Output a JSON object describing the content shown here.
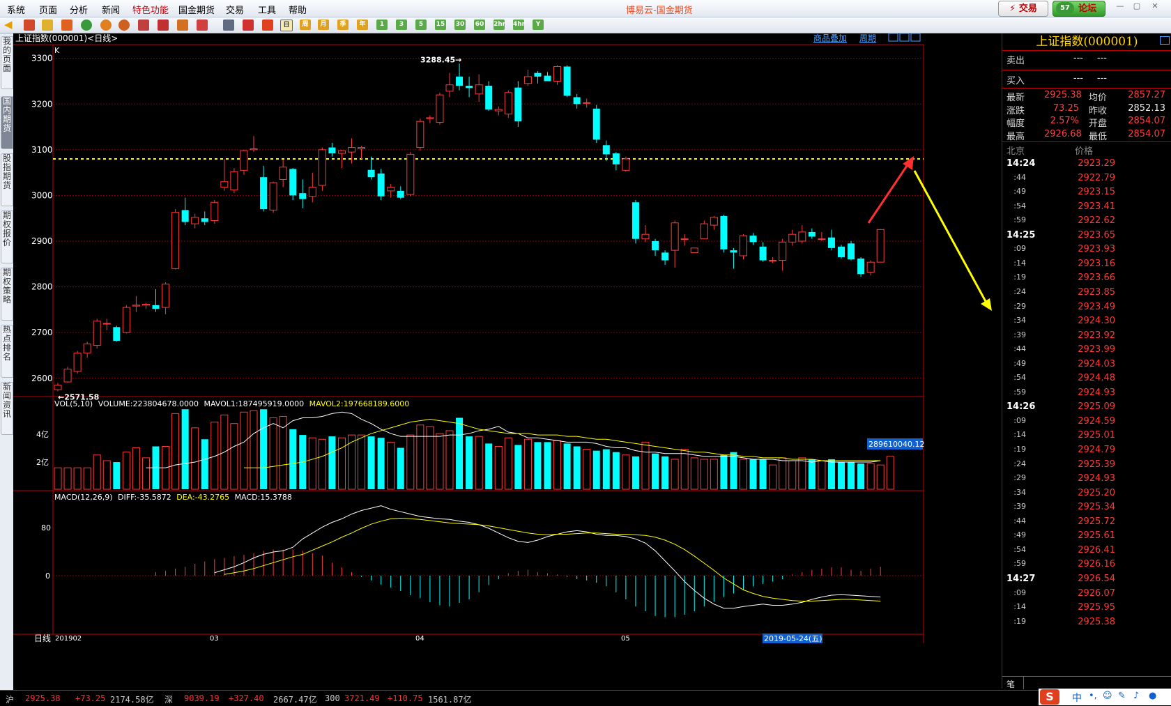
{
  "menu": {
    "items": [
      "系统",
      "页面",
      "分析",
      "新闻",
      "特色功能",
      "国金期货",
      "交易",
      "工具",
      "帮助"
    ],
    "app_title": "博易云-国金期货",
    "trade_button": "⚡ 交易",
    "forum_button": "论坛",
    "forum_badge": "57"
  },
  "toolbar": {
    "period_buttons": [
      "日",
      "周",
      "月",
      "季",
      "年",
      "1",
      "3",
      "5",
      "15",
      "30",
      "60",
      "2hr",
      "4hr",
      "Y"
    ]
  },
  "side_tabs": [
    "我的页面",
    "国内期货",
    "股指期货",
    "期权报价",
    "期权策略",
    "热点排名",
    "新闻资讯"
  ],
  "chart_header": {
    "title": "上证指数(000001)<日线>",
    "overlay_link": "商品叠加",
    "period_link": "周期",
    "k_label": "K"
  },
  "price_axis": [
    "3300",
    "3200",
    "3100",
    "3000",
    "2900",
    "2800",
    "2700",
    "2600"
  ],
  "annotations": {
    "high": "3288.45→",
    "low": "←2571.58"
  },
  "volume_panel": {
    "label": "VOL(5,10)",
    "volume": "VOLUME:223804678.0000",
    "mavol1": "MAVOL1:187495919.0000",
    "mavol2": "MAVOL2:197668189.6000",
    "axis": [
      "4亿",
      "2亿"
    ],
    "tag": "289610040.12"
  },
  "macd_panel": {
    "label": "MACD(12,26,9)",
    "diff": "DIFF:-35.5872",
    "dea": "DEA:-43.2765",
    "macd": "MACD:15.3788",
    "axis": [
      "80",
      "0"
    ]
  },
  "x_axis": {
    "label": "日线",
    "ticks": [
      "201902",
      "03",
      "04",
      "05"
    ],
    "cursor_date": "2019-05-24(五)"
  },
  "colors": {
    "up": "#ff3b3b",
    "down": "#00ffff",
    "bg": "#000000",
    "grid": "#8b0000",
    "dashed": "#ffff00",
    "ma1": "#ffffff",
    "ma2": "#ffff00"
  },
  "quote": {
    "title": "上证指数(000001)",
    "sell_label": "卖出",
    "buy_label": "买入",
    "dashes": "---",
    "rows": [
      {
        "l1": "最新",
        "v1": "2925.38",
        "l2": "均价",
        "v2": "2857.27"
      },
      {
        "l1": "涨跌",
        "v1": "73.25",
        "l2": "昨收",
        "v2": "2852.13"
      },
      {
        "l1": "幅度",
        "v1": "2.57%",
        "l2": "开盘",
        "v2": "2854.07"
      },
      {
        "l1": "最高",
        "v1": "2926.68",
        "l2": "最低",
        "v2": "2854.07"
      }
    ],
    "tick_header_time": "北京",
    "tick_header_price": "价格",
    "ticks": [
      {
        "t": "14:24",
        "p": "2923.29"
      },
      {
        "t": ":44",
        "p": "2922.79"
      },
      {
        "t": ":49",
        "p": "2923.15"
      },
      {
        "t": ":54",
        "p": "2923.41"
      },
      {
        "t": ":59",
        "p": "2922.62"
      },
      {
        "t": "14:25",
        "p": "2923.65"
      },
      {
        "t": ":09",
        "p": "2923.93"
      },
      {
        "t": ":14",
        "p": "2923.16"
      },
      {
        "t": ":19",
        "p": "2923.66"
      },
      {
        "t": ":24",
        "p": "2923.85"
      },
      {
        "t": ":29",
        "p": "2923.49"
      },
      {
        "t": ":34",
        "p": "2924.30"
      },
      {
        "t": ":39",
        "p": "2923.92"
      },
      {
        "t": ":44",
        "p": "2923.99"
      },
      {
        "t": ":49",
        "p": "2924.03"
      },
      {
        "t": ":54",
        "p": "2924.48"
      },
      {
        "t": ":59",
        "p": "2924.93"
      },
      {
        "t": "14:26",
        "p": "2925.09"
      },
      {
        "t": ":09",
        "p": "2924.59"
      },
      {
        "t": ":14",
        "p": "2925.01"
      },
      {
        "t": ":19",
        "p": "2924.79"
      },
      {
        "t": ":24",
        "p": "2925.39"
      },
      {
        "t": ":29",
        "p": "2924.93"
      },
      {
        "t": ":34",
        "p": "2925.20"
      },
      {
        "t": ":39",
        "p": "2925.34"
      },
      {
        "t": ":44",
        "p": "2925.72"
      },
      {
        "t": ":49",
        "p": "2925.61"
      },
      {
        "t": ":54",
        "p": "2926.41"
      },
      {
        "t": ":59",
        "p": "2926.16"
      },
      {
        "t": "14:27",
        "p": "2926.54"
      },
      {
        "t": ":09",
        "p": "2926.07"
      },
      {
        "t": ":14",
        "p": "2925.95"
      },
      {
        "t": ":19",
        "p": "2925.38"
      }
    ],
    "bottom_tab": "笔"
  },
  "status": {
    "sh_label": "沪",
    "sh_price": "2925.38",
    "sh_chg": "+73.25",
    "sh_amt": "2174.58亿",
    "sz_label": "深",
    "sz_price": "9039.19",
    "sz_chg": "+327.40",
    "sz_amt": "2667.47亿",
    "hs_label": "300",
    "hs_price": "3721.49",
    "hs_chg": "+110.75",
    "hs_amt": "1561.87亿",
    "ime": "中"
  },
  "chart_data": {
    "type": "candlestick",
    "title": "上证指数(000001)<日线>",
    "ylim": [
      2560,
      3330
    ],
    "dashed_line": 3080,
    "candles": [
      {
        "o": 2575,
        "h": 2590,
        "l": 2571.58,
        "c": 2585
      },
      {
        "o": 2592,
        "h": 2625,
        "l": 2590,
        "c": 2620
      },
      {
        "o": 2615,
        "h": 2660,
        "l": 2610,
        "c": 2655
      },
      {
        "o": 2655,
        "h": 2680,
        "l": 2645,
        "c": 2675
      },
      {
        "o": 2672,
        "h": 2730,
        "l": 2665,
        "c": 2725
      },
      {
        "o": 2720,
        "h": 2730,
        "l": 2705,
        "c": 2720
      },
      {
        "o": 2712,
        "h": 2715,
        "l": 2680,
        "c": 2682
      },
      {
        "o": 2700,
        "h": 2760,
        "l": 2698,
        "c": 2755
      },
      {
        "o": 2758,
        "h": 2780,
        "l": 2745,
        "c": 2760
      },
      {
        "o": 2760,
        "h": 2765,
        "l": 2752,
        "c": 2762
      },
      {
        "o": 2760,
        "h": 2795,
        "l": 2745,
        "c": 2752
      },
      {
        "o": 2755,
        "h": 2810,
        "l": 2740,
        "c": 2806
      },
      {
        "o": 2840,
        "h": 2970,
        "l": 2838,
        "c": 2963
      },
      {
        "o": 2968,
        "h": 2995,
        "l": 2935,
        "c": 2942
      },
      {
        "o": 2938,
        "h": 2960,
        "l": 2928,
        "c": 2952
      },
      {
        "o": 2950,
        "h": 2965,
        "l": 2935,
        "c": 2942
      },
      {
        "o": 2945,
        "h": 2990,
        "l": 2938,
        "c": 2985
      },
      {
        "o": 3018,
        "h": 3080,
        "l": 3010,
        "c": 3030
      },
      {
        "o": 3012,
        "h": 3060,
        "l": 3005,
        "c": 3052
      },
      {
        "o": 3055,
        "h": 3100,
        "l": 3045,
        "c": 3098
      },
      {
        "o": 3100,
        "h": 3130,
        "l": 3095,
        "c": 3102
      },
      {
        "o": 3040,
        "h": 3065,
        "l": 2965,
        "c": 2970
      },
      {
        "o": 2968,
        "h": 3030,
        "l": 2962,
        "c": 3028
      },
      {
        "o": 3035,
        "h": 3078,
        "l": 3018,
        "c": 3062
      },
      {
        "o": 3058,
        "h": 3060,
        "l": 2990,
        "c": 3000
      },
      {
        "o": 3005,
        "h": 3035,
        "l": 2972,
        "c": 2992
      },
      {
        "o": 2998,
        "h": 3050,
        "l": 2985,
        "c": 3018
      },
      {
        "o": 3022,
        "h": 3105,
        "l": 3010,
        "c": 3100
      },
      {
        "o": 3105,
        "h": 3115,
        "l": 3085,
        "c": 3092
      },
      {
        "o": 3092,
        "h": 3100,
        "l": 3060,
        "c": 3098
      },
      {
        "o": 3095,
        "h": 3125,
        "l": 3070,
        "c": 3105
      },
      {
        "o": 3102,
        "h": 3108,
        "l": 3080,
        "c": 3105
      },
      {
        "o": 3056,
        "h": 3085,
        "l": 3035,
        "c": 3040
      },
      {
        "o": 3048,
        "h": 3058,
        "l": 2990,
        "c": 2998
      },
      {
        "o": 3010,
        "h": 3025,
        "l": 2995,
        "c": 3018
      },
      {
        "o": 3010,
        "h": 3020,
        "l": 2992,
        "c": 2995
      },
      {
        "o": 3002,
        "h": 3095,
        "l": 2998,
        "c": 3090
      },
      {
        "o": 3105,
        "h": 3168,
        "l": 3098,
        "c": 3162
      },
      {
        "o": 3168,
        "h": 3175,
        "l": 3158,
        "c": 3170
      },
      {
        "o": 3160,
        "h": 3225,
        "l": 3155,
        "c": 3220
      },
      {
        "o": 3228,
        "h": 3268,
        "l": 3215,
        "c": 3242
      },
      {
        "o": 3260,
        "h": 3288.45,
        "l": 3230,
        "c": 3240
      },
      {
        "o": 3240,
        "h": 3260,
        "l": 3215,
        "c": 3235
      },
      {
        "o": 3222,
        "h": 3265,
        "l": 3205,
        "c": 3242
      },
      {
        "o": 3240,
        "h": 3250,
        "l": 3185,
        "c": 3188
      },
      {
        "o": 3185,
        "h": 3195,
        "l": 3175,
        "c": 3188
      },
      {
        "o": 3178,
        "h": 3230,
        "l": 3170,
        "c": 3225
      },
      {
        "o": 3236,
        "h": 3250,
        "l": 3150,
        "c": 3162
      },
      {
        "o": 3245,
        "h": 3275,
        "l": 3240,
        "c": 3260
      },
      {
        "o": 3268,
        "h": 3272,
        "l": 3245,
        "c": 3260
      },
      {
        "o": 3262,
        "h": 3270,
        "l": 3250,
        "c": 3250
      },
      {
        "o": 3250,
        "h": 3285,
        "l": 3242,
        "c": 3282
      },
      {
        "o": 3282,
        "h": 3285,
        "l": 3215,
        "c": 3218
      },
      {
        "o": 3215,
        "h": 3222,
        "l": 3190,
        "c": 3200
      },
      {
        "o": 3203,
        "h": 3212,
        "l": 3192,
        "c": 3203
      },
      {
        "o": 3190,
        "h": 3198,
        "l": 3115,
        "c": 3122
      },
      {
        "o": 3110,
        "h": 3120,
        "l": 3075,
        "c": 3090
      },
      {
        "o": 3092,
        "h": 3095,
        "l": 3055,
        "c": 3068
      },
      {
        "o": 3055,
        "h": 3085,
        "l": 3052,
        "c": 3080
      },
      {
        "o": 2985,
        "h": 2990,
        "l": 2895,
        "c": 2905
      },
      {
        "o": 2905,
        "h": 2935,
        "l": 2898,
        "c": 2915
      },
      {
        "o": 2900,
        "h": 2905,
        "l": 2868,
        "c": 2880
      },
      {
        "o": 2875,
        "h": 2880,
        "l": 2848,
        "c": 2858
      },
      {
        "o": 2880,
        "h": 2945,
        "l": 2842,
        "c": 2940
      },
      {
        "o": 2905,
        "h": 2915,
        "l": 2890,
        "c": 2905
      },
      {
        "o": 2875,
        "h": 2885,
        "l": 2875,
        "c": 2885
      },
      {
        "o": 2905,
        "h": 2945,
        "l": 2905,
        "c": 2938
      },
      {
        "o": 2935,
        "h": 2955,
        "l": 2925,
        "c": 2952
      },
      {
        "o": 2955,
        "h": 2958,
        "l": 2875,
        "c": 2882
      },
      {
        "o": 2880,
        "h": 2885,
        "l": 2840,
        "c": 2875
      },
      {
        "o": 2868,
        "h": 2915,
        "l": 2860,
        "c": 2912
      },
      {
        "o": 2912,
        "h": 2918,
        "l": 2892,
        "c": 2898
      },
      {
        "o": 2888,
        "h": 2898,
        "l": 2855,
        "c": 2858
      },
      {
        "o": 2858,
        "h": 2865,
        "l": 2852,
        "c": 2858
      },
      {
        "o": 2858,
        "h": 2905,
        "l": 2835,
        "c": 2898
      },
      {
        "o": 2898,
        "h": 2925,
        "l": 2890,
        "c": 2915
      },
      {
        "o": 2900,
        "h": 2935,
        "l": 2895,
        "c": 2920
      },
      {
        "o": 2920,
        "h": 2928,
        "l": 2905,
        "c": 2910
      },
      {
        "o": 2905,
        "h": 2920,
        "l": 2900,
        "c": 2905
      },
      {
        "o": 2908,
        "h": 2925,
        "l": 2880,
        "c": 2885
      },
      {
        "o": 2888,
        "h": 2892,
        "l": 2862,
        "c": 2865
      },
      {
        "o": 2895,
        "h": 2900,
        "l": 2858,
        "c": 2860
      },
      {
        "o": 2862,
        "h": 2865,
        "l": 2822,
        "c": 2828
      },
      {
        "o": 2832,
        "h": 2858,
        "l": 2825,
        "c": 2854
      },
      {
        "o": 2854.07,
        "h": 2926.68,
        "l": 2854.07,
        "c": 2925.38
      }
    ],
    "volume": [
      1.5,
      1.5,
      1.5,
      1.5,
      2.4,
      2.0,
      1.9,
      2.6,
      2.9,
      2.2,
      3.0,
      3.0,
      5.3,
      5.6,
      4.3,
      3.5,
      4.7,
      5.2,
      4.6,
      5.4,
      5.5,
      5.6,
      5.0,
      5.1,
      4.2,
      3.8,
      3.6,
      3.5,
      3.7,
      3.6,
      3.8,
      3.8,
      3.7,
      3.6,
      3.3,
      2.9,
      3.8,
      4.5,
      4.4,
      3.9,
      4.1,
      5.0,
      3.7,
      3.7,
      3.2,
      3.0,
      3.6,
      3.1,
      3.5,
      3.3,
      3.3,
      3.4,
      3.2,
      3.0,
      2.8,
      2.7,
      2.8,
      2.6,
      2.4,
      2.3,
      3.3,
      2.5,
      2.3,
      2.1,
      2.8,
      2.2,
      2.1,
      2.1,
      2.4,
      2.6,
      2.1,
      2.1,
      2.1,
      1.7,
      2.2,
      2.0,
      2.2,
      2.1,
      2.0,
      2.1,
      1.9,
      1.9,
      1.8,
      1.8,
      1.7,
      2.3
    ],
    "mavol1": [
      1.5,
      1.5,
      1.5,
      1.7,
      1.8,
      1.9,
      2.1,
      2.3,
      2.6,
      3.0,
      3.3,
      3.9,
      4.3,
      4.6,
      4.3,
      4.8,
      5.0,
      5.0,
      5.1,
      5.3,
      5.4,
      5.3,
      4.9,
      4.6,
      4.2,
      3.9,
      3.7,
      3.7,
      3.7,
      3.7,
      3.7,
      3.8,
      3.8,
      3.9,
      4.1,
      4.2,
      4.4,
      4.0,
      3.9,
      3.6,
      3.6,
      3.5,
      3.4,
      3.3,
      3.3,
      3.3,
      3.2,
      3.0,
      2.9,
      2.9,
      2.7,
      2.6,
      2.6,
      2.5,
      2.5,
      2.5,
      2.4,
      2.3,
      2.3,
      2.3,
      2.3,
      2.2,
      2.1,
      2.1,
      2.1,
      2.0,
      2.0,
      2.0,
      1.9,
      2.0,
      1.9,
      1.9,
      1.9,
      1.9,
      1.9,
      2.0
    ],
    "mavol2": [
      1.5,
      1.5,
      1.5,
      1.6,
      1.7,
      1.8,
      1.9,
      2.1,
      2.3,
      2.6,
      2.9,
      3.3,
      3.6,
      3.9,
      4.1,
      4.3,
      4.5,
      4.7,
      4.8,
      4.9,
      4.8,
      4.7,
      4.6,
      4.4,
      4.2,
      4.1,
      4.0,
      3.9,
      3.9,
      3.9,
      3.8,
      3.8,
      3.8,
      3.7,
      3.7,
      3.6,
      3.5,
      3.5,
      3.4,
      3.3,
      3.2,
      3.1,
      3.0,
      2.9,
      2.8,
      2.7,
      2.6,
      2.6,
      2.5,
      2.4,
      2.4,
      2.3,
      2.3,
      2.2,
      2.2,
      2.2,
      2.1,
      2.1,
      2.1,
      2.0,
      2.0,
      2.0,
      2.0,
      2.0,
      2.0,
      2.0
    ],
    "macd_diff": [
      5,
      10,
      15,
      22,
      30,
      36,
      40,
      42,
      48,
      62,
      72,
      82,
      90,
      96,
      104,
      110,
      114,
      118,
      112,
      108,
      104,
      100,
      98,
      96,
      95,
      92,
      90,
      86,
      80,
      72,
      64,
      58,
      56,
      60,
      66,
      70,
      74,
      76,
      74,
      70,
      68,
      68,
      66,
      62,
      55,
      42,
      25,
      8,
      -10,
      -25,
      -38,
      -48,
      -55,
      -55,
      -52,
      -50,
      -48,
      -50,
      -50,
      -48,
      -45,
      -40,
      -36,
      -33,
      -32,
      -33,
      -34,
      -35,
      -36
    ],
    "macd_dea": [
      2,
      5,
      8,
      12,
      17,
      22,
      27,
      32,
      36,
      43,
      50,
      57,
      65,
      72,
      80,
      87,
      92,
      96,
      97,
      96,
      95,
      93,
      91,
      89,
      88,
      87,
      86,
      84,
      81,
      78,
      75,
      72,
      70,
      69,
      70,
      70,
      71,
      72,
      72,
      71,
      70,
      70,
      69,
      68,
      65,
      60,
      53,
      44,
      33,
      21,
      9,
      -4,
      -14,
      -24,
      -30,
      -35,
      -38,
      -40,
      -42,
      -43,
      -43,
      -42,
      -41,
      -40,
      -40,
      -41,
      -42,
      -43
    ],
    "macd_hist": [
      6,
      8,
      12,
      15,
      20,
      24,
      28,
      30,
      33,
      35,
      38,
      42,
      44,
      44,
      44,
      42,
      38,
      34,
      22,
      14,
      6,
      -2,
      -8,
      -15,
      -20,
      -26,
      -33,
      -38,
      -45,
      -50,
      -52,
      -46,
      -40,
      -28,
      -16,
      -6,
      4,
      8,
      10,
      6,
      4,
      2,
      -2,
      -6,
      -8,
      -12,
      -18,
      -28,
      -40,
      -52,
      -60,
      -68,
      -70,
      -70,
      -66,
      -60,
      -52,
      -44,
      -36,
      -30,
      -24,
      -18,
      -14,
      -10,
      -6,
      2,
      6,
      10,
      12,
      14,
      14,
      10,
      8,
      12,
      15
    ],
    "x_ticks": [
      "201902",
      "03",
      "04",
      "05"
    ]
  }
}
